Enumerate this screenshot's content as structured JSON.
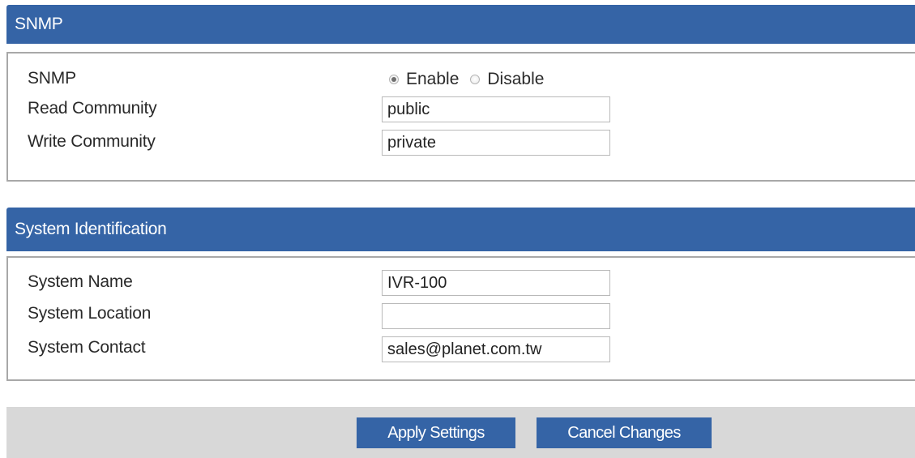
{
  "snmp_section": {
    "title": "SNMP",
    "snmp_label": "SNMP",
    "options": [
      {
        "label": "Enable",
        "checked": true
      },
      {
        "label": "Disable",
        "checked": false
      }
    ],
    "read_community_label": "Read Community",
    "read_community_value": "public",
    "write_community_label": "Write Community",
    "write_community_value": "private"
  },
  "system_section": {
    "title": "System Identification",
    "name_label": "System Name",
    "name_value": "IVR-100",
    "location_label": "System Location",
    "location_value": "",
    "contact_label": "System Contact",
    "contact_value": "sales@planet.com.tw"
  },
  "buttons": {
    "apply": "Apply Settings",
    "cancel": "Cancel Changes"
  },
  "colors": {
    "header_bg": "#3564a6",
    "button_bg": "#3564a6",
    "footer_bg": "#d8d8d8"
  }
}
